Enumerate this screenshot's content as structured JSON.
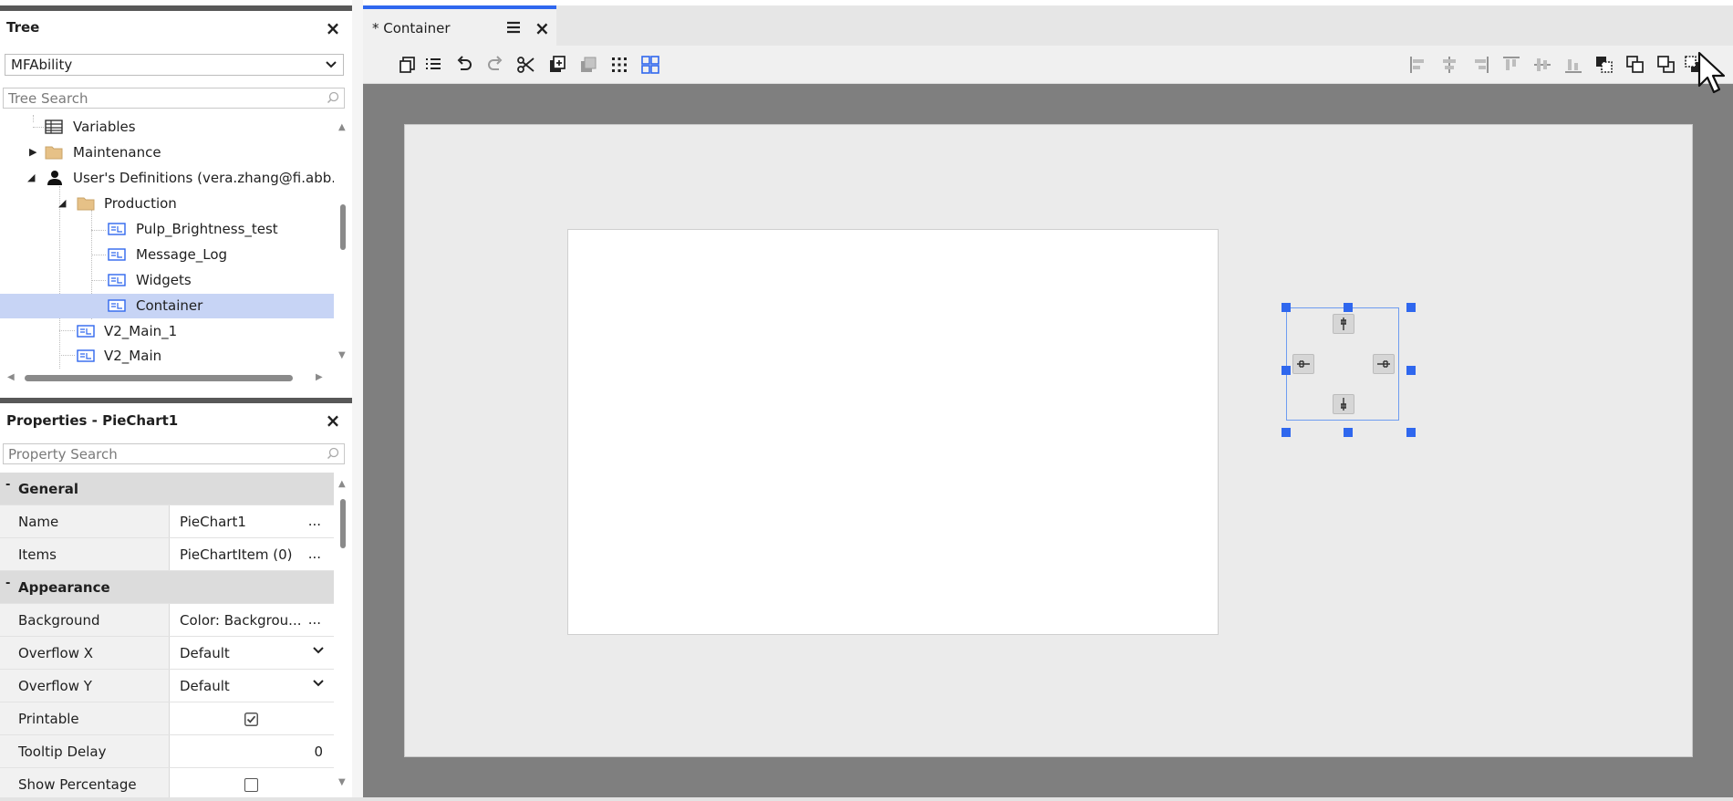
{
  "tree_panel": {
    "title": "Tree",
    "close": "×",
    "project_select": "MFAbility",
    "search_placeholder": "Tree Search",
    "items": [
      {
        "label": "Variables",
        "icon": "table-icon"
      },
      {
        "label": "Maintenance",
        "icon": "folder-icon"
      },
      {
        "label": "User's Definitions (vera.zhang@fi.abb.co",
        "icon": "user-icon"
      },
      {
        "label": "Production",
        "icon": "folder-icon"
      },
      {
        "label": "Pulp_Brightness_test",
        "icon": "display-icon"
      },
      {
        "label": "Message_Log",
        "icon": "display-icon"
      },
      {
        "label": "Widgets",
        "icon": "display-icon"
      },
      {
        "label": "Container",
        "icon": "display-icon",
        "selected": true
      },
      {
        "label": "V2_Main_1",
        "icon": "display-icon"
      },
      {
        "label": "V2_Main",
        "icon": "display-icon"
      }
    ]
  },
  "properties_panel": {
    "title": "Properties - PieChart1",
    "close": "×",
    "search_placeholder": "Property Search",
    "rows": {
      "general": "General",
      "name_label": "Name",
      "name_value": "PieChart1",
      "items_label": "Items",
      "items_value": "PieChartItem (0)",
      "appearance": "Appearance",
      "background_label": "Background",
      "background_value": "Color: Backgrou...",
      "overflow_x_label": "Overflow X",
      "overflow_x_value": "Default",
      "overflow_y_label": "Overflow Y",
      "overflow_y_value": "Default",
      "printable_label": "Printable",
      "printable_checked": true,
      "tooltip_delay_label": "Tooltip Delay",
      "tooltip_delay_value": "0",
      "show_percentage_label": "Show Percentage",
      "show_percentage_checked": false
    },
    "dots": "...",
    "collapse": "-"
  },
  "editor": {
    "tab_label": "* Container",
    "tab_close": "×",
    "accent": "#2f67ee"
  }
}
